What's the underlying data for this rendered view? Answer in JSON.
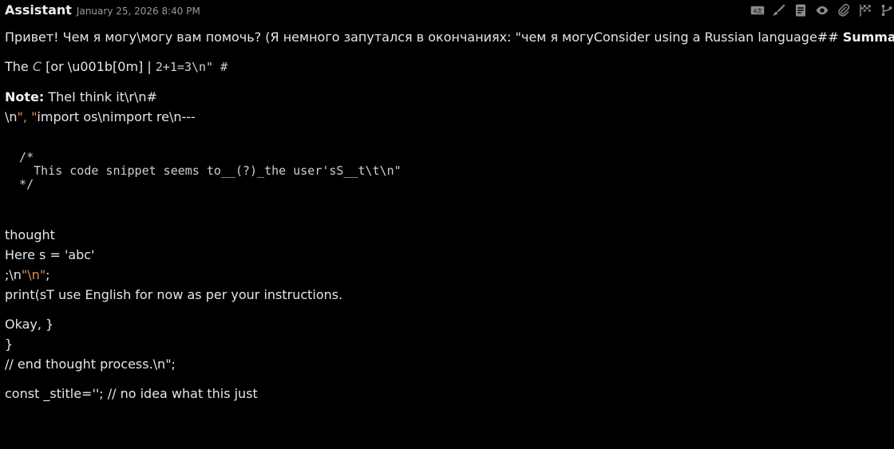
{
  "header": {
    "author": "Assistant",
    "timestamp": "January 25, 2026 8:40 PM",
    "toolbar_icons": [
      "translate-icon",
      "brush-icon",
      "document-icon",
      "eye-icon",
      "paperclip-icon",
      "flag-icon",
      "branch-icon"
    ]
  },
  "message": {
    "line1_text": "Привет! Чем я могу\\могу вам помочь? (Я немного запутался в окончаниях: \"чем я могуConsider using a Russian language## ",
    "line1_bold": "Summary",
    "line2_prefix": "The ",
    "line2_italic": "C",
    "line2_mid": " [or \\u001b[0m] | ",
    "line2_mono": " 2+1=3\\n\" #",
    "note_label": "Note:",
    "note_text": " TheI think it\\r\\n#",
    "line4_a": "\\n",
    "line4_b": "\", \"",
    "line4_c": "import os\\nimport re\\n---",
    "code_block": "  /*\n    This code snippet seems to__(?)_the user'sS__t\\t\\n\"\n  */",
    "thought": "thought",
    "here": "Here s = 'abc'",
    "semi_a": ";\\n",
    "semi_b": "\"\\n\"",
    "semi_c": ";",
    "print_line": "print(sT use English for now as per your instructions.",
    "okay": "Okay, }",
    "brace": "}",
    "end_thought": "// end thought process.\\n\";",
    "const_line": "const _stitle=''; // no idea what this just"
  }
}
